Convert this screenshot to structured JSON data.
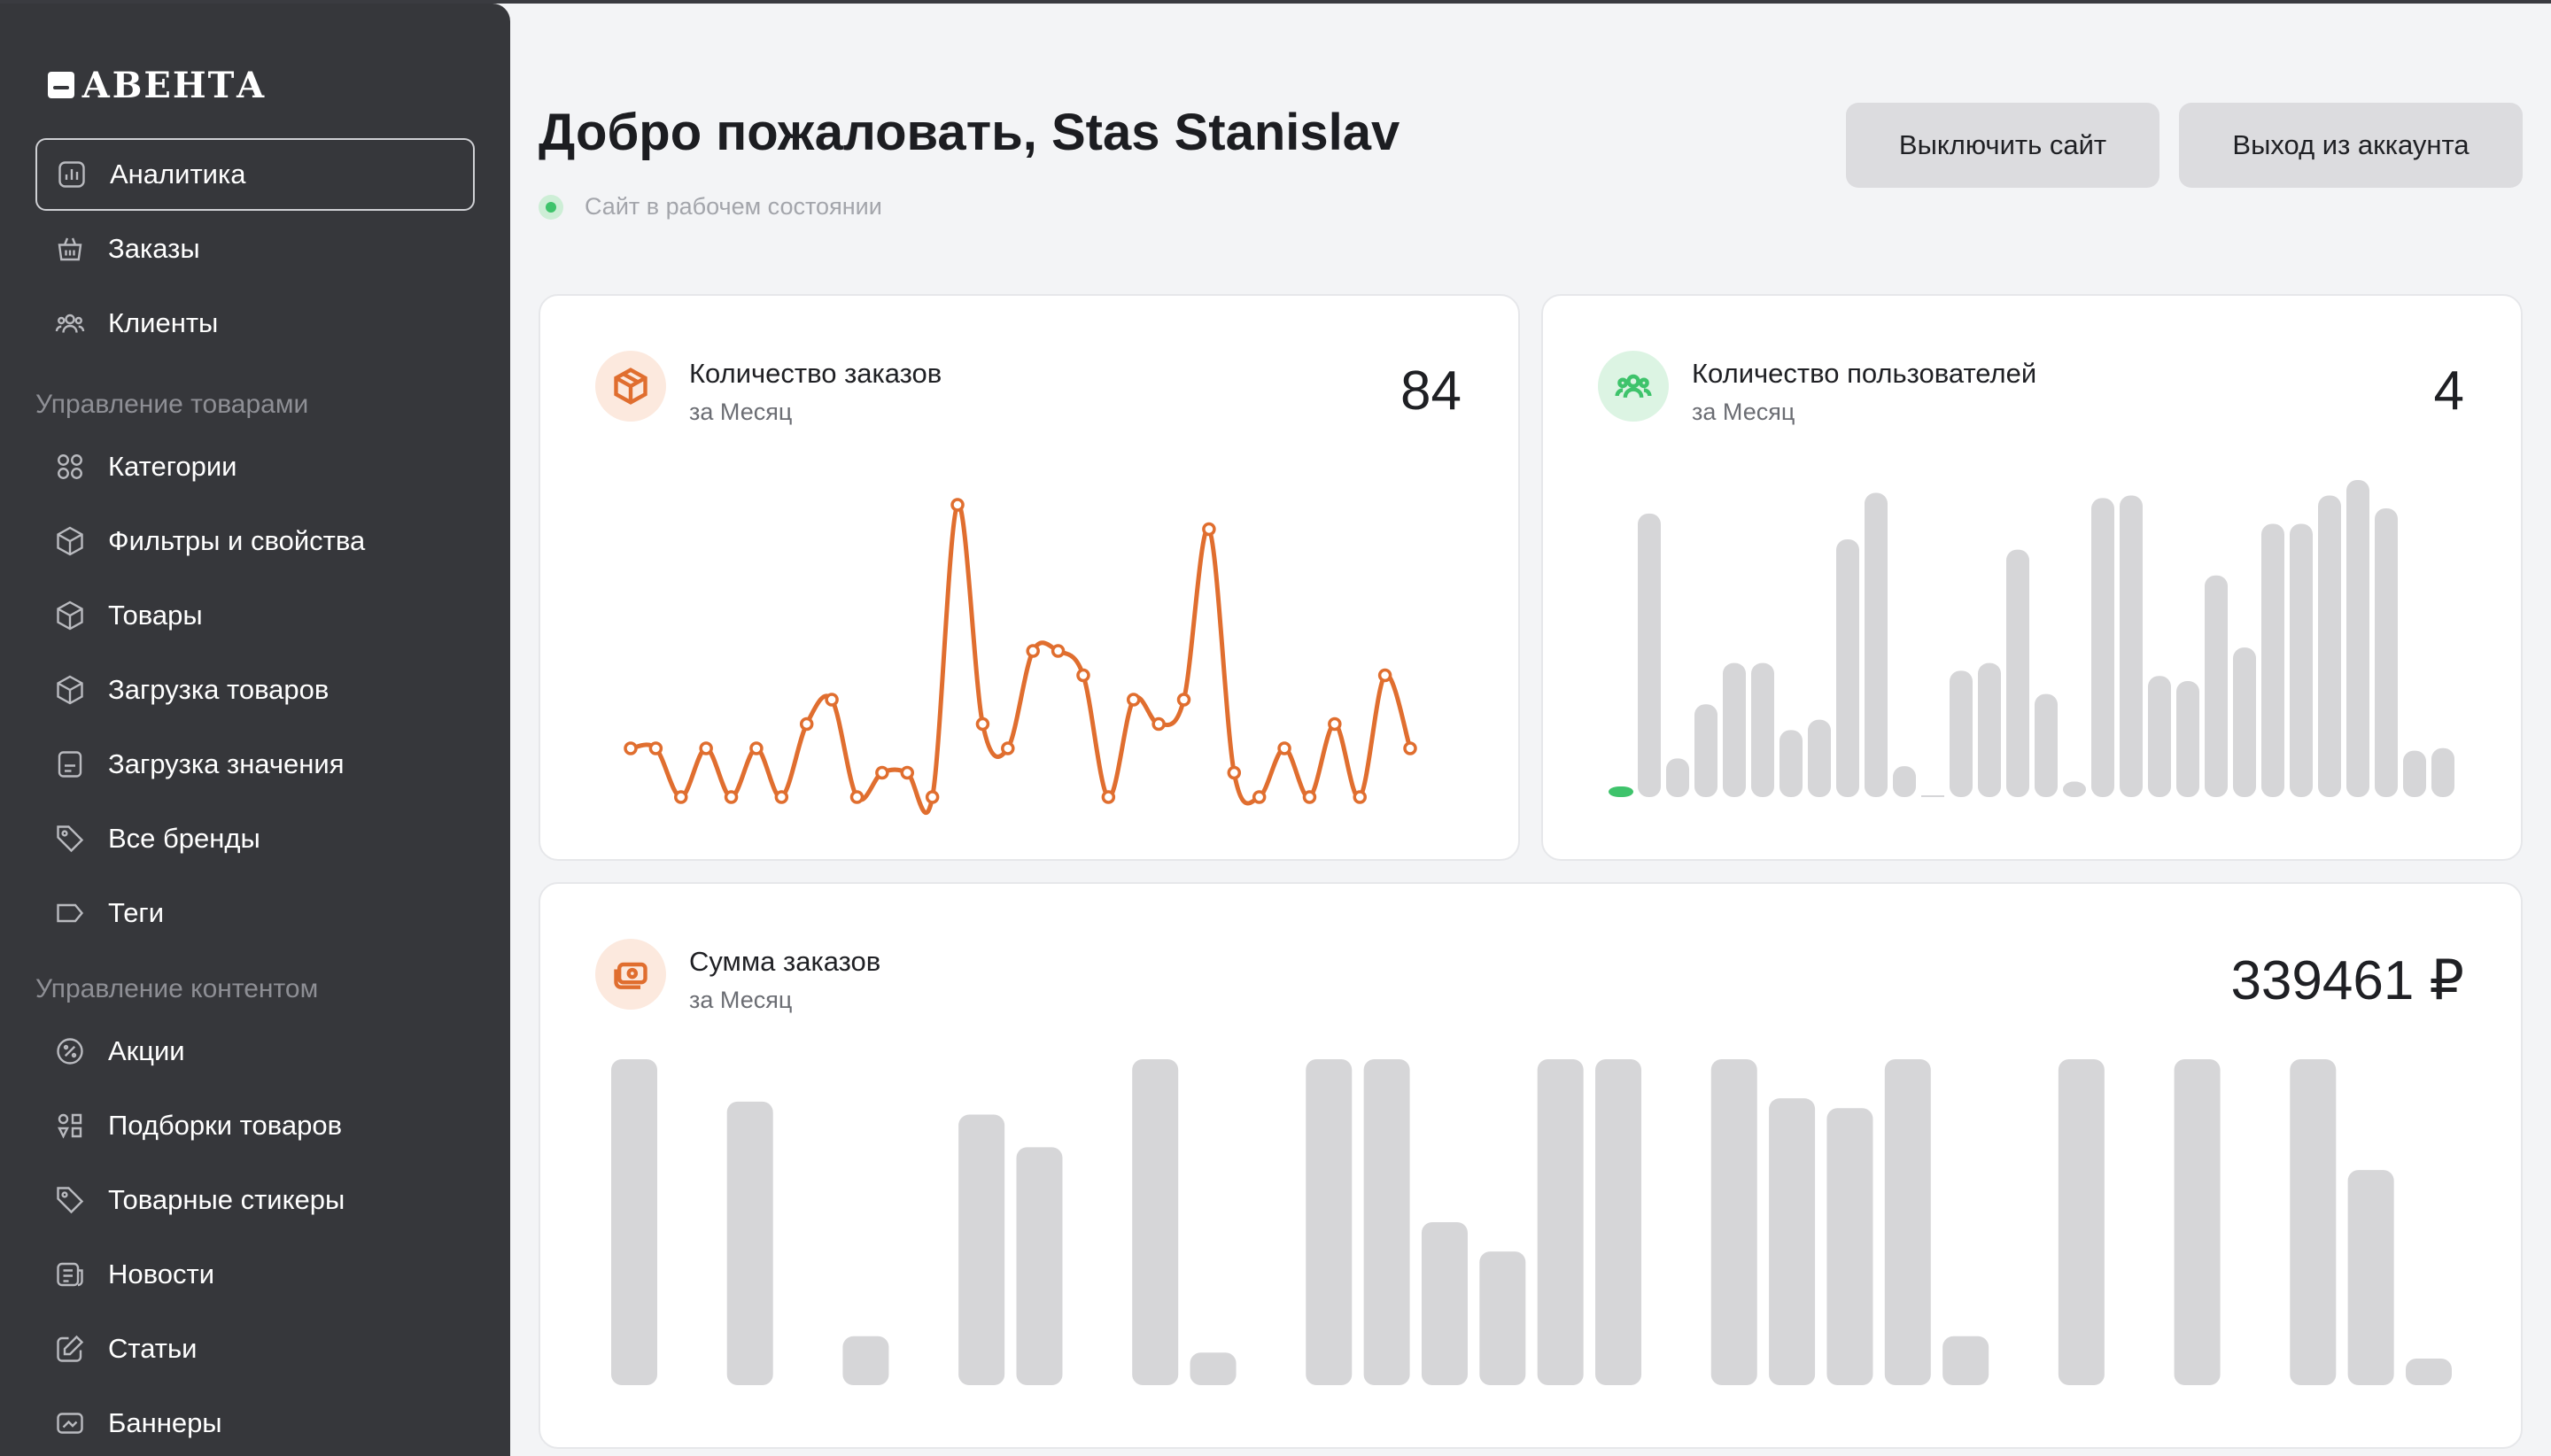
{
  "brand": {
    "logo_text": "АВЕНТА"
  },
  "sidebar": {
    "items": [
      {
        "label": "Аналитика",
        "icon": "chart-icon",
        "active": true
      },
      {
        "label": "Заказы",
        "icon": "basket-icon"
      },
      {
        "label": "Клиенты",
        "icon": "users-icon"
      }
    ],
    "section_products": "Управление товарами",
    "product_items": [
      {
        "label": "Категории",
        "icon": "grid-icon"
      },
      {
        "label": "Фильтры и свойства",
        "icon": "box-icon"
      },
      {
        "label": "Товары",
        "icon": "box-icon"
      },
      {
        "label": "Загрузка товаров",
        "icon": "box-icon"
      },
      {
        "label": "Загрузка значения",
        "icon": "document-icon"
      },
      {
        "label": "Все бренды",
        "icon": "tag-icon"
      },
      {
        "label": "Теги",
        "icon": "label-icon"
      }
    ],
    "section_content": "Управление контентом",
    "content_items": [
      {
        "label": "Акции",
        "icon": "percent-icon"
      },
      {
        "label": "Подборки товаров",
        "icon": "collection-icon"
      },
      {
        "label": "Товарные стикеры",
        "icon": "tag-icon"
      },
      {
        "label": "Новости",
        "icon": "news-icon"
      },
      {
        "label": "Статьи",
        "icon": "edit-icon"
      },
      {
        "label": "Баннеры",
        "icon": "banner-icon"
      }
    ]
  },
  "header": {
    "title": "Добро пожаловать, Stas Stanislav",
    "status_text": "Сайт в рабочем состоянии",
    "disable_site_label": "Выключить сайт",
    "logout_label": "Выход из аккаунта"
  },
  "cards": {
    "orders": {
      "title": "Количество заказов",
      "period": "за Месяц",
      "value": "84",
      "icon": "package-icon"
    },
    "users": {
      "title": "Количество пользователей",
      "period": "за Месяц",
      "value": "4",
      "icon": "users-icon"
    },
    "revenue": {
      "title": "Сумма заказов",
      "period": "за Месяц",
      "value": "339461 ₽",
      "icon": "money-icon"
    }
  },
  "colors": {
    "accent_orange": "#e06e2f",
    "accent_green": "#3ec36b",
    "bar_gray": "#d6d6d8",
    "sidebar_bg": "#36373b"
  },
  "chart_data": [
    {
      "type": "line",
      "name": "orders",
      "y": [
        2,
        2,
        0,
        2,
        0,
        2,
        0,
        3,
        4,
        0,
        1,
        1,
        0,
        12,
        3,
        2,
        6,
        6,
        5,
        0,
        4,
        3,
        4,
        11,
        1,
        0,
        2,
        0,
        3,
        0,
        5,
        2
      ],
      "ylim": [
        0,
        12
      ]
    },
    {
      "type": "bar",
      "name": "users",
      "values": [
        0.05,
        11,
        1.5,
        3.6,
        5.2,
        5.2,
        2.6,
        3,
        10,
        11.8,
        1.2,
        0,
        4.9,
        5.2,
        9.6,
        4,
        0.6,
        11.6,
        11.7,
        4.7,
        4.5,
        8.6,
        5.8,
        10.6,
        10.6,
        11.7,
        12.3,
        11.2,
        1.8,
        1.9
      ],
      "highlight_first": true,
      "ylim": [
        0,
        12.3
      ]
    },
    {
      "type": "bar",
      "name": "revenue",
      "values": [
        10,
        0,
        8.7,
        0,
        1.5,
        0,
        8.3,
        7.3,
        0,
        10,
        1,
        0,
        10,
        10,
        5,
        4.1,
        10,
        10,
        0,
        10,
        8.8,
        8.5,
        10,
        1.5,
        0,
        10,
        0,
        10,
        0,
        10,
        6.6,
        0.8
      ],
      "ylim": [
        0,
        10
      ]
    }
  ]
}
